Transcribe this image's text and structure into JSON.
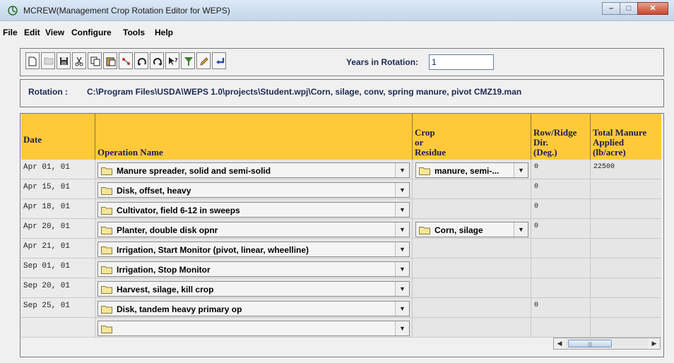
{
  "window": {
    "title": "MCREW(Management Crop Rotation Editor for WEPS)",
    "controls": {
      "minimize": "–",
      "maximize": "□",
      "close": "✕"
    }
  },
  "menu": [
    "File",
    "Edit",
    "View",
    "Configure",
    "Tools",
    "Help"
  ],
  "toolbar": {
    "icons": [
      "new-file-icon",
      "open-file-icon",
      "save-icon",
      "cut-icon",
      "copy-icon",
      "paste-icon",
      "sort-icon",
      "rotate-icon",
      "rotate-reverse-icon",
      "help-pointer-icon",
      "filter-icon",
      "edit-pencil-icon",
      "return-arrow-icon"
    ],
    "years_label": "Years in Rotation:",
    "years_value": "1"
  },
  "rotation": {
    "label": "Rotation :",
    "path": "C:\\Program Files\\USDA\\WEPS 1.0\\projects\\Student.wpj\\Corn, silage, conv, spring manure, pivot CMZ19.man"
  },
  "table": {
    "headers": {
      "date": "Date",
      "operation": "Operation Name",
      "crop": "Crop\nor\nResidue",
      "rowdir": "Row/Ridge\nDir.\n(Deg.)",
      "manure": "Total Manure\nApplied\n(lb/acre)"
    },
    "rows": [
      {
        "date": "Apr 01, 01",
        "operation": "Manure spreader, solid and semi-solid",
        "crop": "manure, semi-...",
        "rowdir": "0",
        "manure": "22500"
      },
      {
        "date": "Apr 15, 01",
        "operation": "Disk, offset, heavy",
        "crop": "",
        "rowdir": "0",
        "manure": ""
      },
      {
        "date": "Apr 18, 01",
        "operation": "Cultivator, field 6-12 in sweeps",
        "crop": "",
        "rowdir": "0",
        "manure": ""
      },
      {
        "date": "Apr 20, 01",
        "operation": "Planter, double disk opnr",
        "crop": "Corn, silage",
        "rowdir": "0",
        "manure": ""
      },
      {
        "date": "Apr 21, 01",
        "operation": "Irrigation, Start Monitor (pivot, linear, wheelline)",
        "crop": "",
        "rowdir": "",
        "manure": ""
      },
      {
        "date": "Sep 01, 01",
        "operation": "Irrigation, Stop Monitor",
        "crop": "",
        "rowdir": "",
        "manure": ""
      },
      {
        "date": "Sep 20, 01",
        "operation": "Harvest, silage, kill crop",
        "crop": "",
        "rowdir": "",
        "manure": ""
      },
      {
        "date": "Sep 25, 01",
        "operation": "Disk, tandem heavy primary op",
        "crop": "",
        "rowdir": "0",
        "manure": ""
      },
      {
        "date": "",
        "operation": "",
        "crop": "",
        "rowdir": "",
        "manure": ""
      }
    ]
  },
  "colors": {
    "header_bg": "#ffc93a",
    "header_text": "#1c1c4a",
    "label_text": "#1c2a52"
  }
}
